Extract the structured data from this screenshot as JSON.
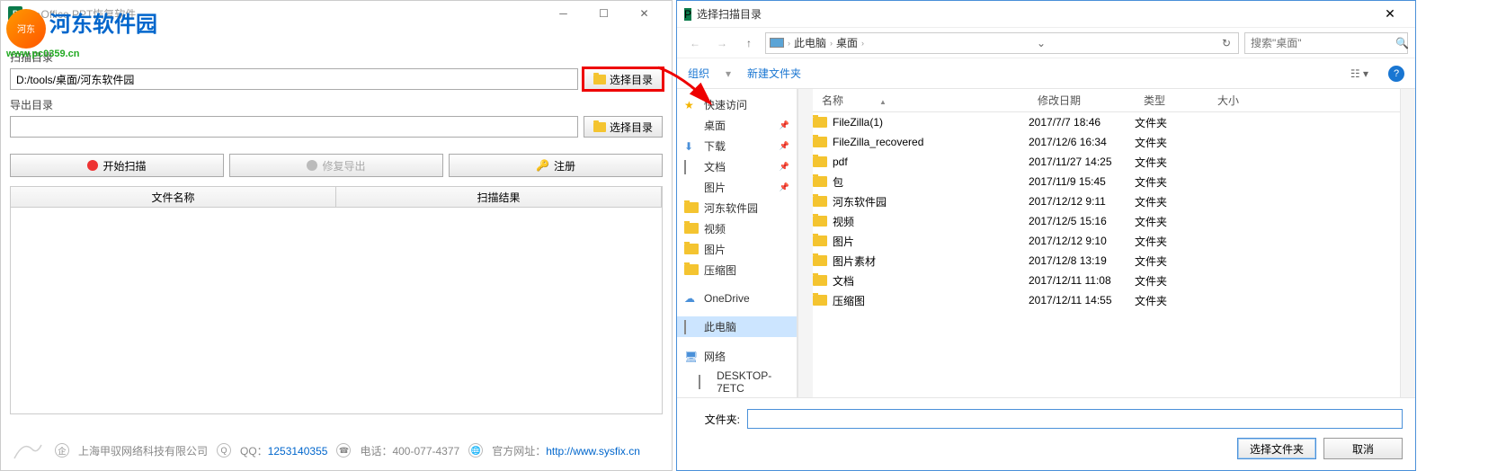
{
  "left": {
    "title": "●●Office PPT恢复软件",
    "watermark": {
      "name": "河东软件园",
      "url": "www.pc0359.cn"
    },
    "scan_dir_label": "扫描目录",
    "scan_dir_value": "D:/tools/桌面/河东软件园",
    "export_dir_label": "导出目录",
    "export_dir_value": "",
    "browse_label": "选择目录",
    "start_scan": "开始扫描",
    "repair_export": "修复导出",
    "register": "注册",
    "col_filename": "文件名称",
    "col_scanresult": "扫描结果",
    "footer": {
      "company": "上海甲驭网络科技有限公司",
      "qq_label": "QQ：",
      "qq": "1253140355",
      "tel_label": "电话：",
      "tel": "400-077-4377",
      "site_label": "官方网址：",
      "site": "http://www.sysfix.cn"
    }
  },
  "right": {
    "title": "选择扫描目录",
    "breadcrumb": [
      "此电脑",
      "桌面"
    ],
    "search_placeholder": "搜索\"桌面\"",
    "organize": "组织",
    "new_folder": "新建文件夹",
    "columns": {
      "name": "名称",
      "date": "修改日期",
      "type": "类型",
      "size": "大小"
    },
    "tree": [
      {
        "label": "快速访问",
        "icon": "star"
      },
      {
        "label": "桌面",
        "icon": "desktop",
        "pinned": true
      },
      {
        "label": "下载",
        "icon": "download",
        "pinned": true
      },
      {
        "label": "文档",
        "icon": "doc",
        "pinned": true
      },
      {
        "label": "图片",
        "icon": "pic",
        "pinned": true
      },
      {
        "label": "河东软件园",
        "icon": "folder"
      },
      {
        "label": "视频",
        "icon": "folder"
      },
      {
        "label": "图片",
        "icon": "folder"
      },
      {
        "label": "压缩图",
        "icon": "folder"
      },
      {
        "label": "OneDrive",
        "icon": "cloud",
        "gap": true
      },
      {
        "label": "此电脑",
        "icon": "pc",
        "gap": true,
        "selected": true
      },
      {
        "label": "网络",
        "icon": "net",
        "gap": true
      },
      {
        "label": "DESKTOP-7ETC",
        "icon": "pc",
        "indent": true
      }
    ],
    "files": [
      {
        "name": "FileZilla(1)",
        "date": "2017/7/7 18:46",
        "type": "文件夹"
      },
      {
        "name": "FileZilla_recovered",
        "date": "2017/12/6 16:34",
        "type": "文件夹"
      },
      {
        "name": "pdf",
        "date": "2017/11/27 14:25",
        "type": "文件夹"
      },
      {
        "name": "包",
        "date": "2017/11/9 15:45",
        "type": "文件夹"
      },
      {
        "name": "河东软件园",
        "date": "2017/12/12 9:11",
        "type": "文件夹"
      },
      {
        "name": "视频",
        "date": "2017/12/5 15:16",
        "type": "文件夹"
      },
      {
        "name": "图片",
        "date": "2017/12/12 9:10",
        "type": "文件夹"
      },
      {
        "name": "图片素材",
        "date": "2017/12/8 13:19",
        "type": "文件夹"
      },
      {
        "name": "文档",
        "date": "2017/12/11 11:08",
        "type": "文件夹"
      },
      {
        "name": "压缩图",
        "date": "2017/12/11 14:55",
        "type": "文件夹"
      }
    ],
    "folder_label": "文件夹:",
    "folder_value": "",
    "select_btn": "选择文件夹",
    "cancel_btn": "取消"
  }
}
